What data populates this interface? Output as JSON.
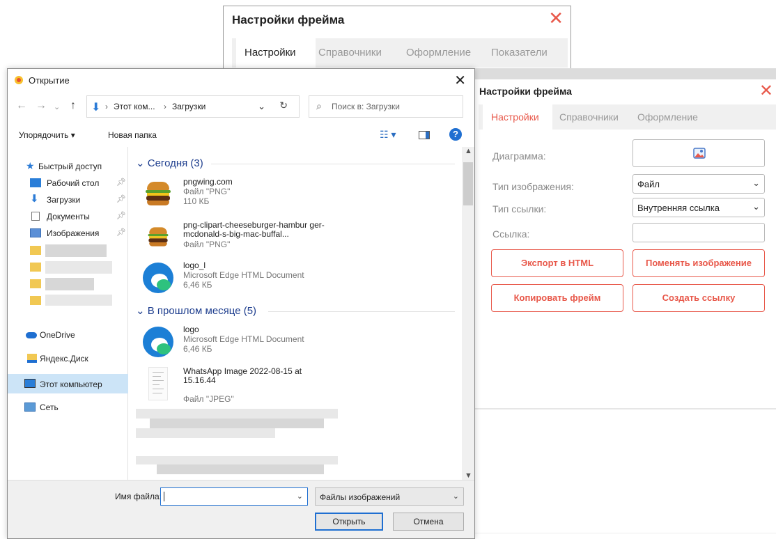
{
  "back_dialog": {
    "title": "Настройки фрейма",
    "close": "✕",
    "tabs": [
      "Настройки",
      "Справочники",
      "Оформление",
      "Показатели"
    ]
  },
  "frame_panel": {
    "title": "Настройки фрейма",
    "close": "✕",
    "tabs": [
      "Настройки",
      "Справочники",
      "Оформление"
    ],
    "active_tab": "Настройки",
    "fields": {
      "diagram_label": "Диаграмма:",
      "image_type_label": "Тип изображения:",
      "image_type_value": "Файл",
      "link_type_label": "Тип ссылки:",
      "link_type_value": "Внутренняя ссылка",
      "link_label": "Ссылка:",
      "link_value": ""
    },
    "buttons": {
      "export_html": "Экспорт в HTML",
      "change_image": "Поменять изображение",
      "copy_frame": "Копировать фрейм",
      "create_link": "Создать ссылку"
    },
    "accent_color": "#e8584a"
  },
  "open_dialog": {
    "title": "Открытие",
    "close": "✕",
    "address": {
      "crumbs": [
        "Этот ком...",
        "Загрузки"
      ]
    },
    "search_placeholder": "Поиск в: Загрузки",
    "toolbar": {
      "organize": "Упорядочить ▾",
      "new_folder": "Новая папка"
    },
    "nav": {
      "quick_access": "Быстрый доступ",
      "desktop": "Рабочий стол",
      "downloads": "Загрузки",
      "documents": "Документы",
      "images": "Изображения",
      "onedrive": "OneDrive",
      "yandex": "Яндекс.Диск",
      "this_pc": "Этот компьютер",
      "network": "Сеть"
    },
    "groups": {
      "today": "Сегодня (3)",
      "last_month": "В прошлом месяце (5)"
    },
    "files": [
      {
        "name": "pngwing.com",
        "meta1": "Файл \"PNG\"",
        "meta2": "110 КБ"
      },
      {
        "name": "png-clipart-cheeseburger-hambur ger-mcdonald-s-big-mac-buffal...",
        "meta1": "Файл \"PNG\"",
        "meta2": ""
      },
      {
        "name": "logo_l",
        "meta1": "Microsoft Edge HTML Document",
        "meta2": "6,46 КБ"
      },
      {
        "name": "logo",
        "meta1": "Microsoft Edge HTML Document",
        "meta2": "6,46 КБ"
      },
      {
        "name": "WhatsApp Image 2022-08-15 at 15.16.44",
        "meta1": "Файл \"JPEG\"",
        "meta2": ""
      }
    ],
    "footer": {
      "filename_label": "Имя файла:",
      "filename_value": "",
      "filetype_value": "Файлы изображений",
      "open_button": "Открыть",
      "cancel_button": "Отмена"
    }
  }
}
